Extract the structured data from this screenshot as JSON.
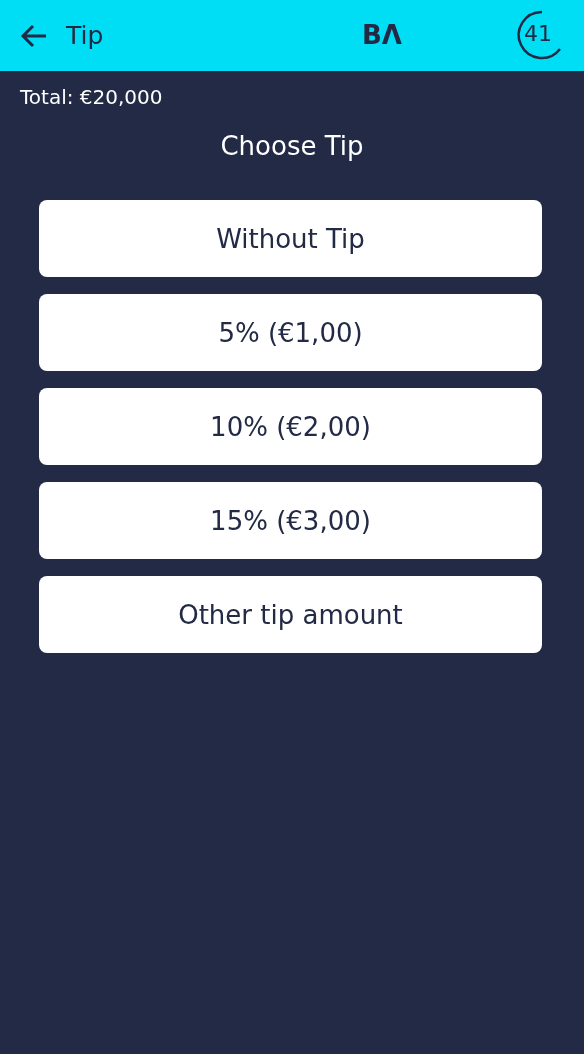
{
  "header": {
    "title": "Tip",
    "logo": "BΛ",
    "timer": "41"
  },
  "total": "Total:  €20,000",
  "heading": "Choose Tip",
  "options": [
    {
      "label": "Without Tip"
    },
    {
      "label": "5% (€1,00)"
    },
    {
      "label": "10% (€2,00)"
    },
    {
      "label": "15% (€3,00)"
    },
    {
      "label": "Other tip amount"
    }
  ]
}
